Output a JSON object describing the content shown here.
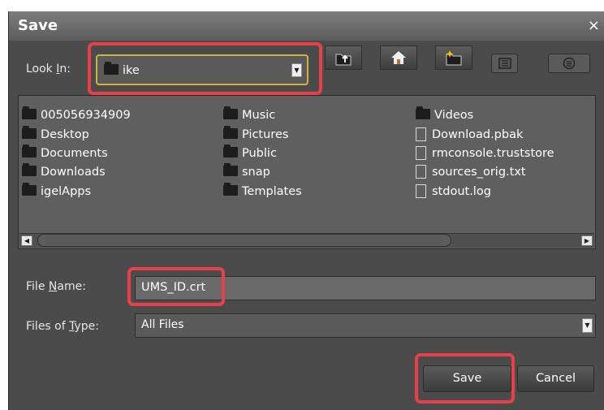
{
  "dialog": {
    "title": "Save",
    "close_glyph": "×"
  },
  "lookin": {
    "label_prefix": "Look ",
    "label_mnemonic": "I",
    "label_suffix": "n:",
    "value": "ike",
    "toolbar": [
      "up-one-level-icon",
      "home-icon",
      "create-new-folder-icon",
      "list-view-icon",
      "details-view-icon"
    ]
  },
  "files": {
    "col1": [
      "005056934909",
      "Desktop",
      "Documents",
      "Downloads",
      "igelApps"
    ],
    "col2": [
      "Music",
      "Pictures",
      "Public",
      "snap",
      "Templates"
    ],
    "col3_folders": [
      "Videos"
    ],
    "col3_files": [
      "Download.pbak",
      "rmconsole.truststore",
      "sources_orig.txt",
      "stdout.log"
    ]
  },
  "filename": {
    "label_prefix": "File ",
    "label_mnemonic": "N",
    "label_suffix": "ame:",
    "value": "UMS_ID.crt"
  },
  "filetype": {
    "label_prefix": "Files of ",
    "label_mnemonic": "T",
    "label_suffix": "ype:",
    "value": "All Files"
  },
  "buttons": {
    "save": "Save",
    "cancel": "Cancel"
  },
  "colors": {
    "highlight": "#e8404a",
    "dialog_bg": "#4b4b4b"
  }
}
